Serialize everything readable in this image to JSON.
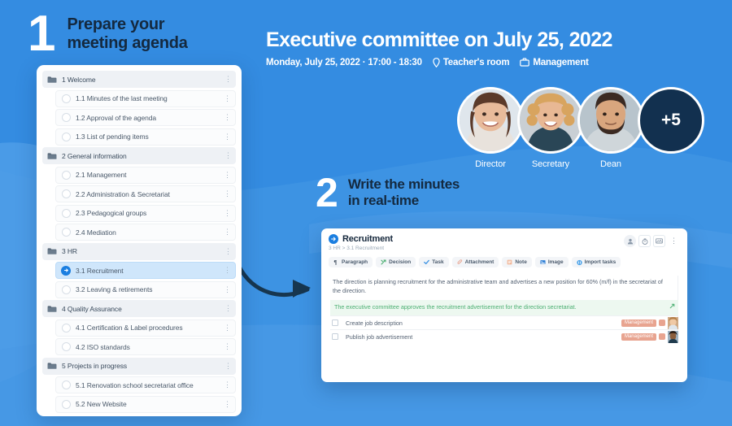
{
  "colors": {
    "bg_blue": "#3d93e3",
    "bg_blue_dark": "#2e86e0",
    "bg_blue_light": "#4f9ee7",
    "accent": "#1a7ee0",
    "navy": "#14293f",
    "decision_green": "#4caf72",
    "tag_salmon": "#e8a490",
    "white": "#ffffff"
  },
  "steps": [
    {
      "number": "1",
      "line1": "Prepare your",
      "line2": "meeting agenda"
    },
    {
      "number": "2",
      "line1": "Write the minutes",
      "line2": "in real-time"
    }
  ],
  "agenda": {
    "items": [
      {
        "type": "section",
        "icon": "folder-icon",
        "label": "1 Welcome",
        "menu": "⋮"
      },
      {
        "type": "child",
        "icon": "circle-icon",
        "label": "1.1 Minutes of the last meeting",
        "menu": "⋮"
      },
      {
        "type": "child",
        "icon": "circle-icon",
        "label": "1.2 Approval of the agenda",
        "menu": "⋮"
      },
      {
        "type": "child",
        "icon": "circle-icon",
        "label": "1.3 List of pending items",
        "menu": "⋮"
      },
      {
        "type": "section",
        "icon": "folder-icon",
        "label": "2 General information",
        "menu": "⋮"
      },
      {
        "type": "child",
        "icon": "circle-icon",
        "label": "2.1 Management",
        "menu": "⋮"
      },
      {
        "type": "child",
        "icon": "circle-icon",
        "label": "2.2 Administration & Secretariat",
        "menu": "⋮"
      },
      {
        "type": "child",
        "icon": "circle-icon",
        "label": "2.3 Pedagogical groups",
        "menu": "⋮"
      },
      {
        "type": "child",
        "icon": "circle-icon",
        "label": "2.4 Mediation",
        "menu": "⋮"
      },
      {
        "type": "section",
        "icon": "folder-icon",
        "label": "3 HR",
        "menu": "⋮"
      },
      {
        "type": "child",
        "icon": "arrow-right-icon",
        "label": "3.1 Recruitment",
        "menu": "⋮",
        "active": true
      },
      {
        "type": "child",
        "icon": "circle-icon",
        "label": "3.2 Leaving & retirements",
        "menu": "⋮"
      },
      {
        "type": "section",
        "icon": "folder-icon",
        "label": "4 Quality Assurance",
        "menu": "⋮"
      },
      {
        "type": "child",
        "icon": "circle-icon",
        "label": "4.1 Certification & Label procedures",
        "menu": "⋮"
      },
      {
        "type": "child",
        "icon": "circle-icon",
        "label": "4.2 ISO standards",
        "menu": "⋮"
      },
      {
        "type": "section",
        "icon": "folder-icon",
        "label": "5 Projects in progress",
        "menu": "⋮"
      },
      {
        "type": "child",
        "icon": "circle-icon",
        "label": "5.1 Renovation school secretariat office",
        "menu": "⋮"
      },
      {
        "type": "child",
        "icon": "circle-icon",
        "label": "5.2 New Website",
        "menu": "⋮"
      }
    ]
  },
  "meeting": {
    "title": "Executive committee on July 25, 2022",
    "date_time": "Monday, July 25, 2022 · 17:00 - 18:30",
    "location": "Teacher's room",
    "category": "Management",
    "location_icon": "pin-icon",
    "category_icon": "briefcase-icon"
  },
  "participants": {
    "people": [
      {
        "role": "Director",
        "avatar": "woman-brown-hair-avatar"
      },
      {
        "role": "Secretary",
        "avatar": "woman-blonde-curly-avatar"
      },
      {
        "role": "Dean",
        "avatar": "man-beard-avatar"
      }
    ],
    "overflow_label": "+5"
  },
  "editor": {
    "title": "Recruitment",
    "title_icon": "arrow-right-circle-icon",
    "breadcrumb": "3 HR > 3.1 Recruitment",
    "header_icons": [
      "person-icon",
      "timer-icon",
      "presentation-icon",
      "more-vertical-icon"
    ],
    "toolbar": [
      {
        "label": "Paragraph",
        "icon": "pilcrow-icon"
      },
      {
        "label": "Decision",
        "icon": "decision-icon"
      },
      {
        "label": "Task",
        "icon": "check-icon"
      },
      {
        "label": "Attachment",
        "icon": "paperclip-icon"
      },
      {
        "label": "Note",
        "icon": "note-icon"
      },
      {
        "label": "Image",
        "icon": "image-icon"
      },
      {
        "label": "Import tasks",
        "icon": "import-icon"
      }
    ],
    "paragraph": "The direction is planning recruitment for the administrative team and advertises a new position for 60% (m/f) in the secretariat of the direction.",
    "decision": "The executive committee approves the recruitment advertisement for the direction secretariat.",
    "decision_icon": "arrow-out-icon",
    "tasks": [
      {
        "label": "Create job description",
        "tag": "Management",
        "assignee_avatar": "woman-avatar-thumb"
      },
      {
        "label": "Publish job advertisement",
        "tag": "Management",
        "assignee_avatar": "woman-dark-avatar-thumb"
      }
    ]
  },
  "connector": {
    "icon": "curved-arrow-icon"
  }
}
